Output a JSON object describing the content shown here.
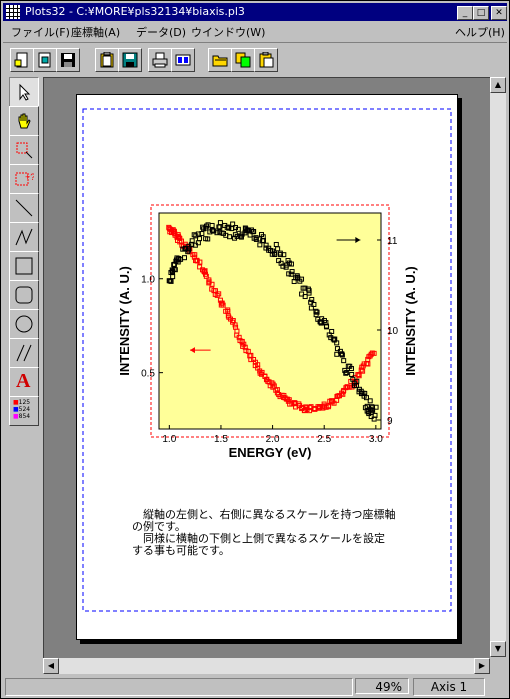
{
  "window": {
    "title": "Plots32 - C:¥MORE¥pls32134¥biaxis.pl3",
    "min": "_",
    "max": "□",
    "close": "✕"
  },
  "menu": {
    "left": [
      "ファイル(F)",
      "座標軸(A)",
      "データ(D)",
      "ウインドウ(W)"
    ],
    "help": "ヘルプ(H)"
  },
  "toolbar": [
    "new-icon",
    "open-icon",
    "save-icon",
    "clipboard-icon",
    "save-disk-icon",
    "print-icon",
    "preview-icon",
    "folder-open-icon",
    "copy-icon",
    "paste-icon"
  ],
  "tools": [
    "pointer-tool",
    "hand-tool",
    "select-region-tool",
    "point-query-tool",
    "line-tool",
    "polyline-tool",
    "rectangle-tool",
    "rounded-rect-tool",
    "ellipse-tool",
    "hatch-tool",
    "text-tool",
    "data-label-tool"
  ],
  "tool_labels": {
    "text": "A",
    "data": [
      "125",
      "524",
      "854"
    ]
  },
  "caption": "　縦軸の左側と、右側に異なるスケールを持つ座標軸\nの例です。\n　同様に横軸の下側と上側で異なるスケールを設定\nする事も可能です。",
  "status": {
    "zoom": "49%",
    "axis": "Axis 1"
  },
  "colors": {
    "title": "#000080",
    "plot_bg": "#ffff99",
    "left_series": "#ff0000",
    "right_series": "#000000",
    "frame": "#ff0000",
    "page_border": "#0000ff"
  },
  "chart_data": {
    "type": "scatter",
    "xlabel": "ENERGY (eV)",
    "ylabel": "INTENSITY (A. U.)",
    "ylabel_right": "INTENSITY (A. U.)",
    "x_ticks": [
      "1.0",
      "1.5",
      "2.0",
      "2.5",
      "3.0"
    ],
    "y_left_ticks": [
      "0.5",
      "1.0"
    ],
    "y_right_ticks": [
      "9",
      "10",
      "11"
    ],
    "xlim": [
      0.9,
      3.05
    ],
    "ylim_left": [
      0.2,
      1.35
    ],
    "ylim_right": [
      8.9,
      11.3
    ],
    "series": [
      {
        "axis": "left",
        "color": "#ff0000",
        "x": [
          1.0,
          1.05,
          1.1,
          1.2,
          1.3,
          1.4,
          1.5,
          1.6,
          1.7,
          1.8,
          1.9,
          2.0,
          2.1,
          2.2,
          2.3,
          2.4,
          2.5,
          2.6,
          2.7,
          2.8,
          2.9,
          3.0
        ],
        "y": [
          1.27,
          1.24,
          1.21,
          1.15,
          1.07,
          0.98,
          0.88,
          0.78,
          0.67,
          0.58,
          0.49,
          0.43,
          0.37,
          0.33,
          0.31,
          0.31,
          0.32,
          0.35,
          0.4,
          0.46,
          0.54,
          0.62
        ]
      },
      {
        "axis": "right",
        "color": "#000000",
        "x": [
          1.0,
          1.05,
          1.1,
          1.2,
          1.3,
          1.4,
          1.5,
          1.6,
          1.7,
          1.8,
          1.9,
          2.0,
          2.1,
          2.2,
          2.3,
          2.4,
          2.5,
          2.6,
          2.7,
          2.8,
          2.9,
          2.95,
          3.0
        ],
        "y": [
          10.55,
          10.7,
          10.8,
          10.95,
          11.05,
          11.1,
          11.12,
          11.1,
          11.08,
          11.05,
          11.0,
          10.9,
          10.78,
          10.62,
          10.45,
          10.27,
          10.08,
          9.85,
          9.62,
          9.4,
          9.22,
          9.12,
          9.05
        ]
      }
    ],
    "annotations": [
      {
        "type": "arrow",
        "direction": "left",
        "axis": "left"
      },
      {
        "type": "arrow",
        "direction": "right",
        "axis": "right"
      }
    ]
  }
}
